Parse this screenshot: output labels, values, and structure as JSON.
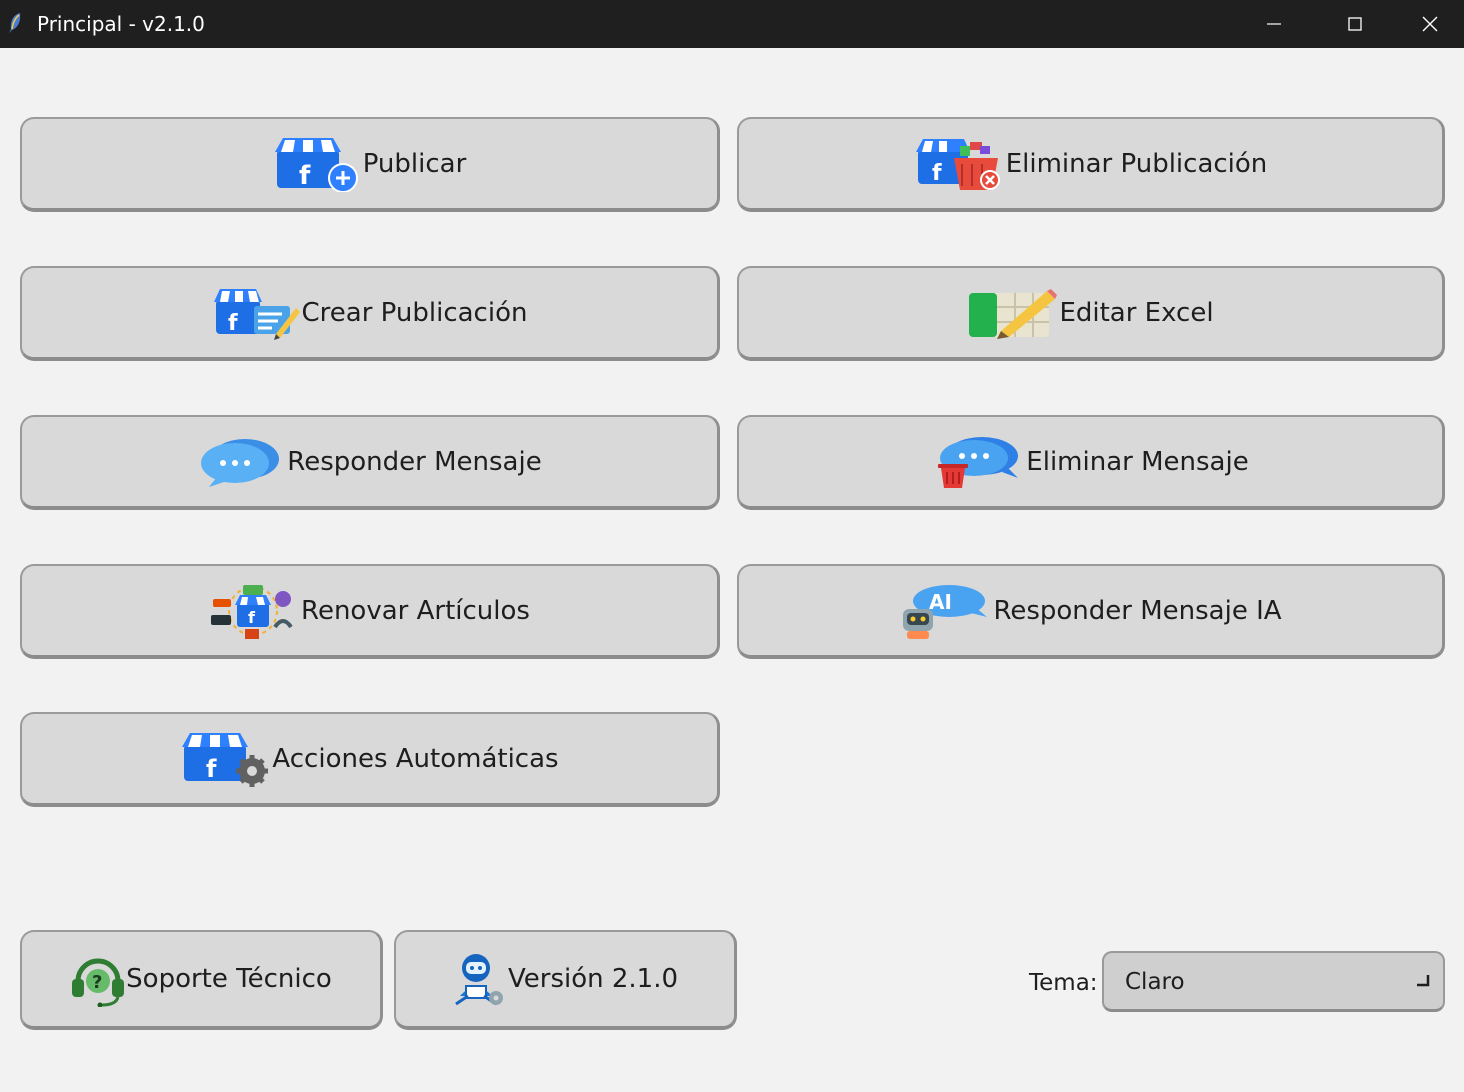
{
  "window": {
    "title": "Principal - v2.1.0",
    "icon": "python-feather-icon"
  },
  "buttons": {
    "publicar": "Publicar",
    "eliminar_publicacion": "Eliminar Publicación",
    "crear_publicacion": "Crear Publicación",
    "editar_excel": "Editar Excel",
    "responder_mensaje": "Responder Mensaje",
    "eliminar_mensaje": "Eliminar Mensaje",
    "renovar_articulos": "Renovar Artículos",
    "responder_mensaje_ia": "Responder Mensaje IA",
    "acciones_automaticas": "Acciones Automáticas"
  },
  "footer": {
    "soporte": "Soporte Técnico",
    "version": "Versión 2.1.0",
    "theme_label": "Tema:",
    "theme_value": "Claro"
  },
  "colors": {
    "titlebar": "#1f1f1f",
    "background": "#f2f2f2",
    "button": "#d9d9d9",
    "accent_blue": "#2f6fdc",
    "store_blue": "#1e6ee6"
  }
}
